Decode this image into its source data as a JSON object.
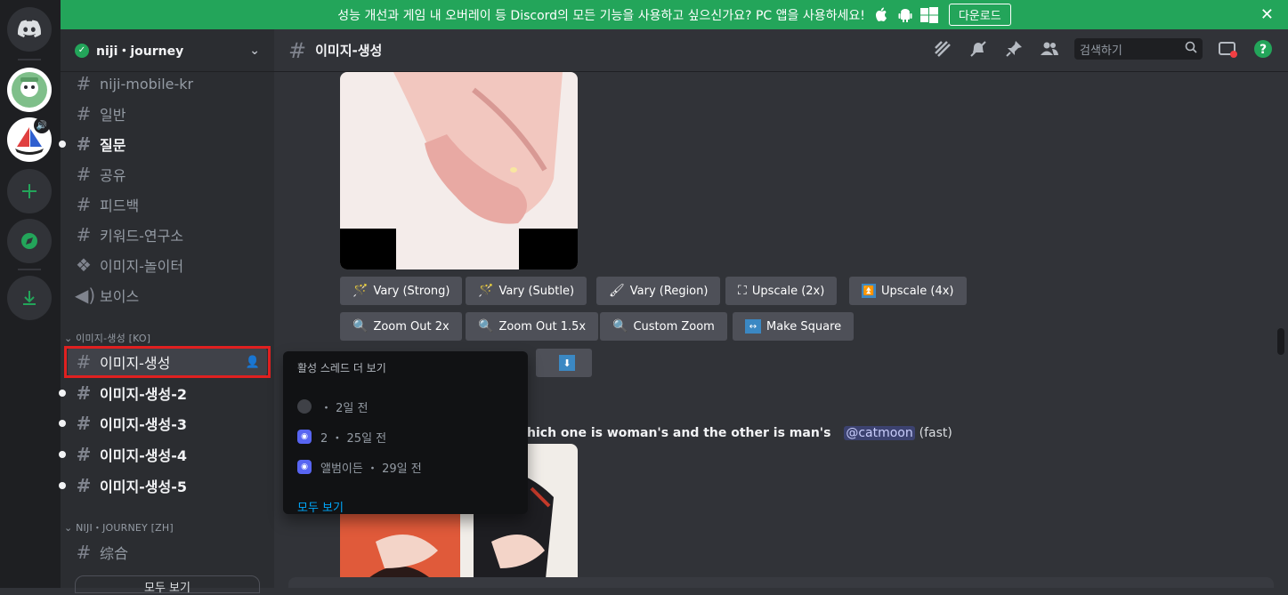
{
  "banner": {
    "text": "성능 개선과 게임 내 오버레이 등 Discord의 모든 기능을 사용하고 싶으신가요? PC 앱을 사용하세요!",
    "download_label": "다운로드",
    "close_label": "✕"
  },
  "server": {
    "name": "niji・journey",
    "chevron": "⌄"
  },
  "channels": [
    {
      "name": "niji-mobile-kr"
    },
    {
      "name": "일반"
    },
    {
      "name": "질문"
    },
    {
      "name": "공유"
    },
    {
      "name": "피드백"
    },
    {
      "name": "키워드-연구소"
    },
    {
      "name": "이미지-놀이터"
    },
    {
      "name": "보이스"
    }
  ],
  "categories": {
    "gen_kr": "이미지-생성 [KO]",
    "niji_zh": "NIJI・JOURNEY [ZH]"
  },
  "gen_channels": [
    "이미지-생성",
    "이미지-생성-2",
    "이미지-생성-3",
    "이미지-생성-4",
    "이미지-생성-5"
  ],
  "zh_channel": "综合",
  "more_label": "모두 보기",
  "popup": {
    "title": "활성 스레드 더 보기",
    "rows": [
      {
        "text": "・ 2일 전"
      },
      {
        "text": "2 ・ 25일 전"
      },
      {
        "text": "앨범이든 ・ 29일 전"
      }
    ],
    "link": "모두 보기"
  },
  "topbar": {
    "channel": "이미지-생성",
    "search_placeholder": "검색하기"
  },
  "buttons": {
    "row1": [
      "Vary (Strong)",
      "Vary (Subtle)",
      "Vary (Region)",
      "Upscale (2x)",
      "Upscale (4x)"
    ],
    "row2": [
      "Zoom Out 2x",
      "Zoom Out 1.5x",
      "Custom Zoom",
      "Make Square"
    ]
  },
  "message": {
    "text": "hich one is woman's and the other is man's",
    "mention": "@catmoon",
    "speed": "(fast)"
  },
  "colors": {
    "accent": "#5865f2",
    "green": "#23a55a",
    "highlight": "#e02020"
  }
}
